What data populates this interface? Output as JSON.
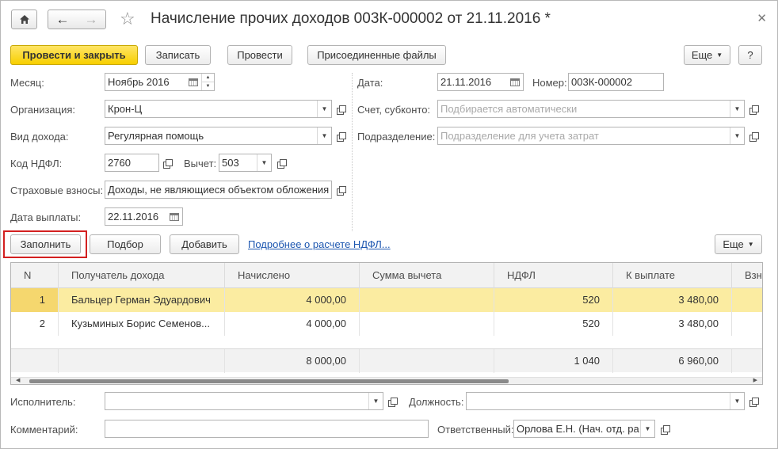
{
  "window": {
    "title": "Начисление прочих доходов 003К-000002 от 21.11.2016 *",
    "close_icon": "close-icon"
  },
  "toolbar": {
    "post_close": "Провести и закрыть",
    "save": "Записать",
    "post": "Провести",
    "attachments": "Присоединенные файлы",
    "more": "Еще",
    "help": "?"
  },
  "form": {
    "month_label": "Месяц:",
    "month_value": "Ноябрь 2016",
    "org_label": "Организация:",
    "org_value": "Крон-Ц",
    "income_type_label": "Вид дохода:",
    "income_type_value": "Регулярная помощь",
    "ndfl_code_label": "Код НДФЛ:",
    "ndfl_code_value": "2760",
    "deduction_label": "Вычет:",
    "deduction_value": "503",
    "insurance_label": "Страховые взносы:",
    "insurance_value": "Доходы, не являющиеся объектом обложения",
    "pay_date_label": "Дата выплаты:",
    "pay_date_value": "22.11.2016",
    "date_label": "Дата:",
    "date_value": "21.11.2016",
    "number_label": "Номер:",
    "number_value": "003К-000002",
    "account_label": "Счет, субконто:",
    "account_placeholder": "Подбирается автоматически",
    "division_label": "Подразделение:",
    "division_placeholder": "Подразделение для учета затрат"
  },
  "table_toolbar": {
    "fill": "Заполнить",
    "select": "Подбор",
    "add": "Добавить",
    "ndfl_link": "Подробнее о расчете НДФЛ...",
    "more": "Еще"
  },
  "table": {
    "columns": [
      "N",
      "Получатель дохода",
      "Начислено",
      "Сумма вычета",
      "НДФЛ",
      "К выплате",
      "Взн"
    ],
    "rows": [
      {
        "n": "1",
        "recipient": "Бальцер Герман Эдуардович",
        "accrued": "4 000,00",
        "deduction": "",
        "ndfl": "520",
        "payout": "3 480,00"
      },
      {
        "n": "2",
        "recipient": "Кузьминых Борис Семенов...",
        "accrued": "4 000,00",
        "deduction": "",
        "ndfl": "520",
        "payout": "3 480,00"
      }
    ],
    "totals": {
      "accrued": "8 000,00",
      "ndfl": "1 040",
      "payout": "6 960,00"
    }
  },
  "footer": {
    "executor_label": "Исполнитель:",
    "executor_value": "",
    "position_label": "Должность:",
    "position_value": "",
    "comment_label": "Комментарий:",
    "comment_value": "",
    "responsible_label": "Ответственный:",
    "responsible_value": "Орлова Е.Н. (Нач. отд. ра"
  },
  "colors": {
    "primary_button": "#f7cf00",
    "selected_row": "#fbeca1",
    "highlight_frame": "#d32020",
    "link": "#1c56b0"
  }
}
